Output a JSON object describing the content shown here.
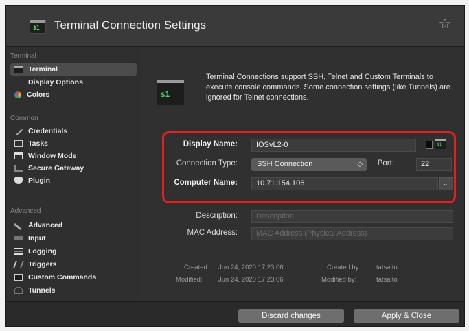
{
  "window": {
    "title": "Terminal Connection Settings",
    "star_glyph": "☆",
    "app_icon_text": "$1"
  },
  "sidebar": {
    "sections": [
      {
        "label": "Terminal",
        "items": [
          {
            "label": "Terminal",
            "icon": "terminal-icon",
            "selected": true
          },
          {
            "label": "Display Options",
            "icon": "none"
          },
          {
            "label": "Colors",
            "icon": "colors-icon"
          }
        ]
      },
      {
        "label": "Common",
        "items": [
          {
            "label": "Credentials",
            "icon": "key-icon"
          },
          {
            "label": "Tasks",
            "icon": "tasks-icon"
          },
          {
            "label": "Window Mode",
            "icon": "window-icon"
          },
          {
            "label": "Secure Gateway",
            "icon": "gateway-icon"
          },
          {
            "label": "Plugin",
            "icon": "plugin-icon"
          }
        ]
      },
      {
        "label": "Advanced",
        "items": [
          {
            "label": "Advanced",
            "icon": "wrench-icon"
          },
          {
            "label": "Input",
            "icon": "keyboard-icon"
          },
          {
            "label": "Logging",
            "icon": "logging-icon"
          },
          {
            "label": "Triggers",
            "icon": "triggers-icon"
          },
          {
            "label": "Custom Commands",
            "icon": "custom-commands-icon"
          },
          {
            "label": "Tunnels",
            "icon": "tunnels-icon"
          }
        ]
      }
    ]
  },
  "main": {
    "header_icon_text": "$1",
    "description": "Terminal Connections support SSH, Telnet and Custom Terminals to execute console commands. Some connection settings (like Tunnels) are ignored for Telnet connections.",
    "display_name": {
      "label": "Display Name:",
      "value": "IOSvL2-0"
    },
    "connection_type": {
      "label": "Connection Type:",
      "value": "SSH Connection",
      "port_label": "Port:",
      "port_value": "22"
    },
    "computer_name": {
      "label": "Computer Name:",
      "value": "10.71.154.106",
      "browse_label": "..."
    },
    "description_field": {
      "label": "Description:",
      "placeholder": "Description"
    },
    "mac_address": {
      "label": "MAC Address:",
      "placeholder": "MAC Address (Physical Address)"
    },
    "meta": {
      "created_label": "Created:",
      "created_value": "Jun 24, 2020 17:23:06",
      "created_by_label": "Created by:",
      "created_by_value": "tatsaito",
      "modified_label": "Modified:",
      "modified_value": "Jun 24, 2020 17:23:06",
      "modified_by_label": "Modified by:",
      "modified_by_value": "tatsaito"
    }
  },
  "footer": {
    "discard_label": "Discard changes",
    "apply_label": "Apply & Close"
  },
  "colors": {
    "highlight": "#e41f1f",
    "terminal_green": "#4fd35f"
  }
}
